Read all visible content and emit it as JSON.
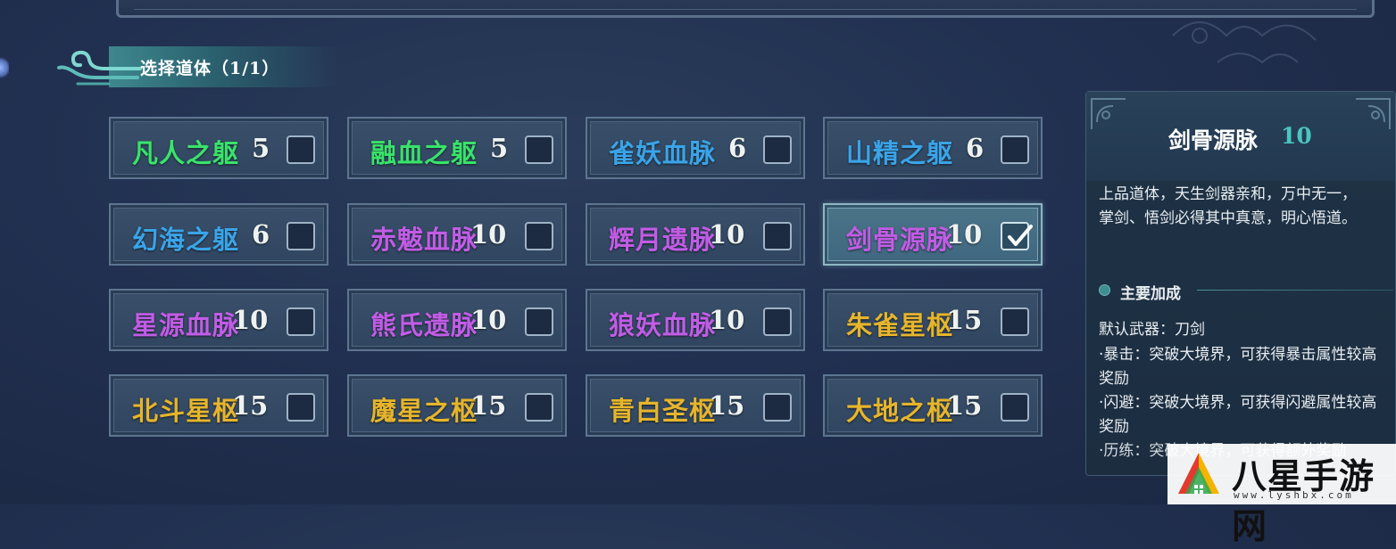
{
  "header": {
    "title": "选择道体（1/1）"
  },
  "cells": [
    {
      "name": "凡人之躯",
      "num": "5",
      "color": "#39e36a",
      "selected": false
    },
    {
      "name": "融血之躯",
      "num": "5",
      "color": "#39e36a",
      "selected": false
    },
    {
      "name": "雀妖血脉",
      "num": "6",
      "color": "#3aa4e8",
      "selected": false
    },
    {
      "name": "山精之躯",
      "num": "6",
      "color": "#3aa4e8",
      "selected": false
    },
    {
      "name": "幻海之躯",
      "num": "6",
      "color": "#3aa4e8",
      "selected": false
    },
    {
      "name": "赤魃血脉",
      "num": "10",
      "color": "#c25ce6",
      "selected": false
    },
    {
      "name": "辉月遗脉",
      "num": "10",
      "color": "#c25ce6",
      "selected": false
    },
    {
      "name": "剑骨源脉",
      "num": "10",
      "color": "#c25ce6",
      "selected": true
    },
    {
      "name": "星源血脉",
      "num": "10",
      "color": "#c25ce6",
      "selected": false
    },
    {
      "name": "熊氏遗脉",
      "num": "10",
      "color": "#c25ce6",
      "selected": false
    },
    {
      "name": "狼妖血脉",
      "num": "10",
      "color": "#c25ce6",
      "selected": false
    },
    {
      "name": "朱雀星枢",
      "num": "15",
      "color": "#e6b52b",
      "selected": false
    },
    {
      "name": "北斗星枢",
      "num": "15",
      "color": "#e6b52b",
      "selected": false
    },
    {
      "name": "魔星之枢",
      "num": "15",
      "color": "#e6b52b",
      "selected": false
    },
    {
      "name": "青白圣枢",
      "num": "15",
      "color": "#e6b52b",
      "selected": false
    },
    {
      "name": "大地之枢",
      "num": "15",
      "color": "#e6b52b",
      "selected": false
    }
  ],
  "detail": {
    "title": "剑骨源脉",
    "num": "10",
    "description": "上品道体，天生剑器亲和，万中无一，掌剑、悟剑必得其中真意，明心悟道。",
    "section": "主要加成",
    "weapon": "默认武器：刀剑",
    "bonuses": [
      "·暴击：突破大境界，可获得暴击属性较高奖励",
      "·闪避：突破大境界，可获得闪避属性较高奖励",
      "·历练：突破大境界，可获得额外奖励"
    ]
  },
  "watermark": {
    "text": "八星手游网",
    "url": "www.lyshbx.com"
  }
}
